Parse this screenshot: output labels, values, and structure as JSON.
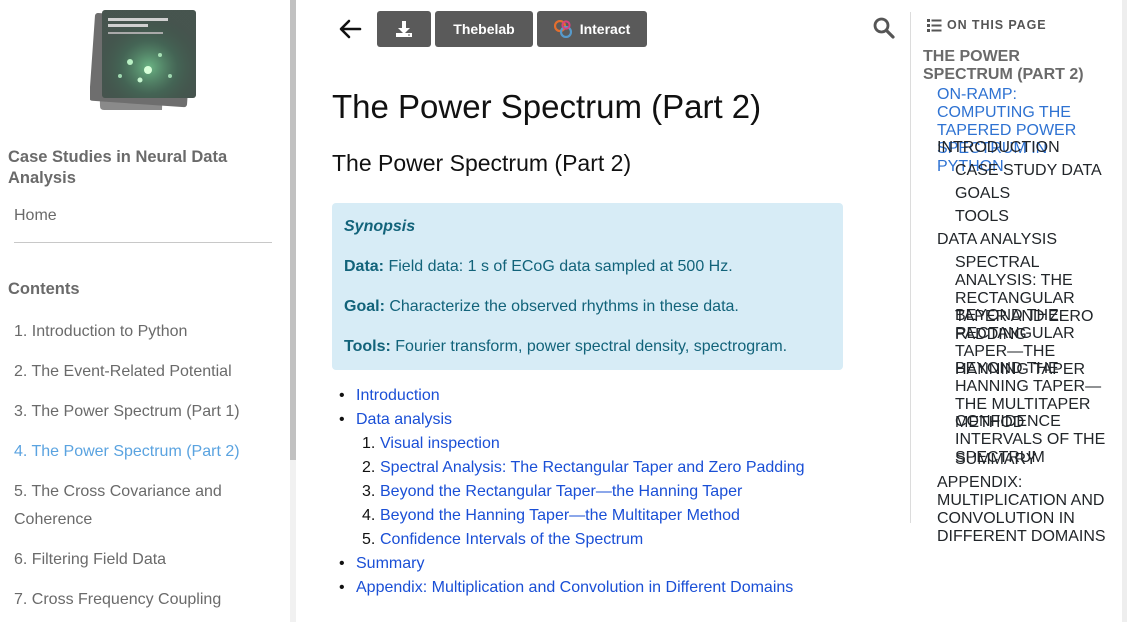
{
  "sidebar": {
    "book_title": "Case Studies in Neural Data Analysis",
    "home": "Home",
    "contents_title": "Contents",
    "items": [
      {
        "label": "1. Introduction to Python",
        "active": false
      },
      {
        "label": "2. The Event-Related Potential",
        "active": false
      },
      {
        "label": "3. The Power Spectrum (Part 1)",
        "active": false
      },
      {
        "label": "4. The Power Spectrum (Part 2)",
        "active": true
      },
      {
        "label": "5. The Cross Covariance and Coherence",
        "active": false
      },
      {
        "label": "6. Filtering Field Data",
        "active": false
      },
      {
        "label": "7. Cross Frequency Coupling",
        "active": false
      }
    ]
  },
  "toolbar": {
    "back_icon": "arrow-left-icon",
    "download_icon": "download-icon",
    "thebelab_label": "Thebelab",
    "interact_label": "Interact",
    "interact_icon": "jupyter-icon"
  },
  "main": {
    "title": "The Power Spectrum (Part 2)",
    "subtitle": "The Power Spectrum (Part 2)",
    "synopsis": {
      "title": "Synopsis",
      "data_label": "Data:",
      "data_text": "Field data: 1 s of ECoG data sampled at 500 Hz.",
      "goal_label": "Goal:",
      "goal_text": "Characterize the observed rhythms in these data.",
      "tools_label": "Tools:",
      "tools_text": "Fourier transform, power spectral density, spectrogram."
    },
    "links": {
      "introduction": "Introduction",
      "data_analysis": "Data analysis",
      "sub": [
        {
          "num": "1.",
          "label": "Visual inspection"
        },
        {
          "num": "2.",
          "label": "Spectral Analysis: The Rectangular Taper and Zero Padding"
        },
        {
          "num": "3.",
          "label": "Beyond the Rectangular Taper—the Hanning Taper"
        },
        {
          "num": "4.",
          "label": "Beyond the Hanning Taper—the Multitaper Method"
        },
        {
          "num": "5.",
          "label": "Confidence Intervals of the Spectrum"
        }
      ],
      "summary": "Summary",
      "appendix": "Appendix: Multiplication and Convolution in Different Domains"
    }
  },
  "right_panel": {
    "search_icon": "search-icon",
    "heading": "ON THIS PAGE",
    "items": [
      {
        "label": "THE POWER SPECTRUM (PART 2)",
        "level": 0
      },
      {
        "label": "ON-RAMP: COMPUTING THE TAPERED POWER SPECTRUM IN PYTHON",
        "level": 1,
        "active": true
      },
      {
        "label": "INTRODUCTION",
        "level": 1
      },
      {
        "label": "CASE STUDY DATA",
        "level": 2
      },
      {
        "label": "GOALS",
        "level": 2
      },
      {
        "label": "TOOLS",
        "level": 2
      },
      {
        "label": "DATA ANALYSIS",
        "level": 1
      },
      {
        "label": "SPECTRAL ANALYSIS: THE RECTANGULAR TAPER AND ZERO PADDING",
        "level": 2
      },
      {
        "label": "BEYOND THE RECTANGULAR TAPER—THE HANNING TAPER",
        "level": 2
      },
      {
        "label": "BEYOND THE HANNING TAPER—THE MULTITAPER METHOD",
        "level": 2
      },
      {
        "label": "CONFIDENCE INTERVALS OF THE SPECTRUM",
        "level": 2
      },
      {
        "label": "SUMMARY",
        "level": 2
      },
      {
        "label": "APPENDIX: MULTIPLICATION AND CONVOLUTION IN DIFFERENT DOMAINS",
        "level": 1
      }
    ]
  }
}
